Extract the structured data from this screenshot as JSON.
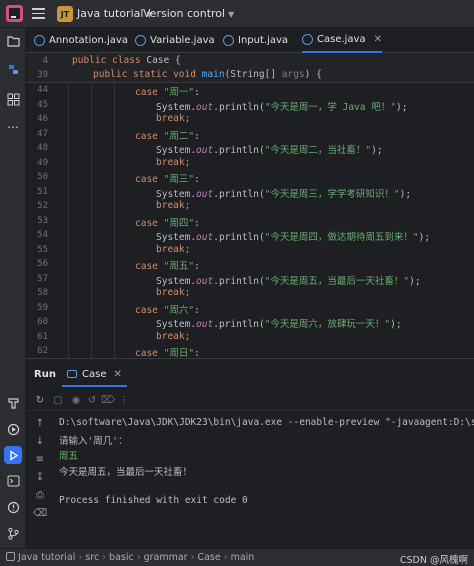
{
  "titlebar": {
    "project_badge": "JT",
    "project_name": "Java tutorial",
    "vcs_label": "Version control"
  },
  "tabs": [
    {
      "label": "Annotation.java",
      "active": false
    },
    {
      "label": "Variable.java",
      "active": false
    },
    {
      "label": "Input.java",
      "active": false
    },
    {
      "label": "Case.java",
      "active": true
    }
  ],
  "editor": {
    "sticky": [
      {
        "ln": "4",
        "text": "public class Case {"
      },
      {
        "ln": "39",
        "text": "public static void main(String[] args) {"
      }
    ],
    "lines": [
      {
        "ln": "44",
        "kind": "case",
        "value": "\"周一\""
      },
      {
        "ln": "45",
        "kind": "print",
        "value": "\"今天是周一，学 Java 吧！\""
      },
      {
        "ln": "46",
        "kind": "break"
      },
      {
        "ln": "47",
        "kind": "case",
        "value": "\"周二\""
      },
      {
        "ln": "48",
        "kind": "print",
        "value": "\"今天是周二，当社畜！\""
      },
      {
        "ln": "49",
        "kind": "break"
      },
      {
        "ln": "50",
        "kind": "case",
        "value": "\"周三\""
      },
      {
        "ln": "51",
        "kind": "print",
        "value": "\"今天是周三，学学考研知识！\""
      },
      {
        "ln": "52",
        "kind": "break"
      },
      {
        "ln": "53",
        "kind": "case",
        "value": "\"周四\""
      },
      {
        "ln": "54",
        "kind": "print",
        "value": "\"今天是周四，做达期待周五到来！\""
      },
      {
        "ln": "55",
        "kind": "break"
      },
      {
        "ln": "56",
        "kind": "case",
        "value": "\"周五\""
      },
      {
        "ln": "57",
        "kind": "print",
        "value": "\"今天是周五，当最后一天社畜！\""
      },
      {
        "ln": "58",
        "kind": "break"
      },
      {
        "ln": "59",
        "kind": "case",
        "value": "\"周六\""
      },
      {
        "ln": "60",
        "kind": "print",
        "value": "\"今天是周六，放肆玩一天！\""
      },
      {
        "ln": "61",
        "kind": "break"
      },
      {
        "ln": "62",
        "kind": "case",
        "value": "\"周日\""
      }
    ],
    "tokens": {
      "case_kw": "case",
      "break_kw": "break;",
      "system": "System.",
      "out": "out",
      "println": ".println(",
      "end": ");",
      "colon": ":"
    }
  },
  "run_panel": {
    "title": "Run",
    "tab_label": "Case",
    "console": [
      {
        "text": "D:\\software\\Java\\JDK\\JDK23\\bin\\java.exe --enable-preview \"-javaagent:D:\\softwar",
        "type": "output"
      },
      {
        "text": "请输入'周几'：",
        "type": "output"
      },
      {
        "text": "周五",
        "type": "input"
      },
      {
        "text": "今天是周五，当最后一天社畜！",
        "type": "output"
      },
      {
        "text": "",
        "type": "output"
      },
      {
        "text": "Process finished with exit code 0",
        "type": "output"
      }
    ]
  },
  "statusbar": {
    "breadcrumb": [
      "Java tutorial",
      "src",
      "basic",
      "grammar",
      "Case",
      "main"
    ],
    "watermark": "CSDN @风槐啊"
  },
  "colors": {
    "background": "#1e1f22",
    "panel": "#2b2d30",
    "accent": "#3574f0",
    "keyword": "#cf8e6d",
    "string": "#6aab73",
    "field": "#c77dbb",
    "function": "#56a8f5",
    "input_text": "#5fb865"
  }
}
